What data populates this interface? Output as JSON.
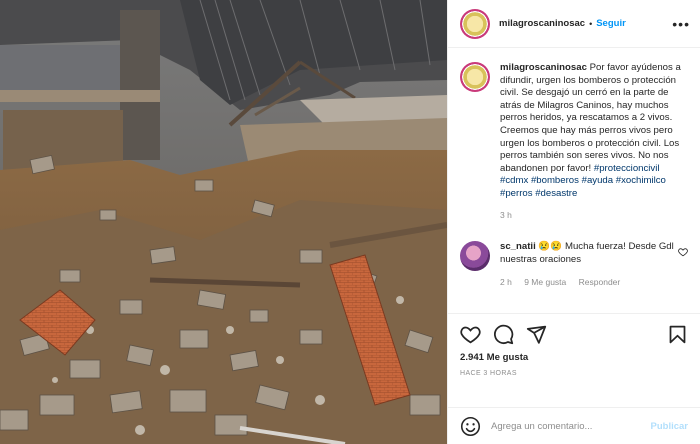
{
  "post": {
    "image_alt": "",
    "author": "milagroscaninosac",
    "follow_label": "Seguir",
    "separator": "•",
    "caption_prefix": "Por favor ayúdenos a difundir, urgen los bomberos o protección civil. Se desgajó un cerró en la parte de atrás de Milagros Caninos, hay muchos perros heridos, ya rescatamos a 2 vivos. Creemos que hay más perros vivos pero urgen los bomberos o protección civil. Los perros también son seres vivos. No nos abandonen por favor!",
    "hashtags": [
      "#proteccioncivil",
      "#cdmx",
      "#bomberos",
      "#ayuda",
      "#xochimilco",
      "#perros",
      "#desastre"
    ],
    "caption_time": "3 h"
  },
  "reply": {
    "user": "sc_natii",
    "emojis": "😢😢",
    "text": "Mucha fuerza! Desde Gdl nuestras oraciones",
    "time": "2 h",
    "likes": "9 Me gusta",
    "reply_label": "Responder"
  },
  "actions": {
    "likes": "2.941 Me gusta",
    "ago": "HACE 3 HORAS"
  },
  "comment_box": {
    "placeholder": "Agrega un comentario...",
    "publish": "Publicar"
  },
  "icons": [
    "more-options-icon",
    "heart-icon",
    "comment-icon",
    "share-icon",
    "bookmark-icon",
    "emoji-icon"
  ],
  "colors": {
    "accent": "#0095f6",
    "link": "#00376b",
    "muted": "#8e8e8e",
    "publish_disabled": "#b2dffc"
  }
}
